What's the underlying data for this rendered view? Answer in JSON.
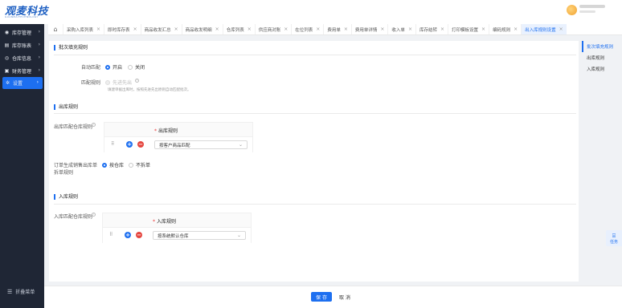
{
  "app": {
    "logo_text": "观麦科技",
    "logo_sub": "GUANMAITECHNOLOGY"
  },
  "sidebar": {
    "items": [
      {
        "label": "库存管理",
        "icon": "inventory-icon"
      },
      {
        "label": "库存账表",
        "icon": "ledger-icon"
      },
      {
        "label": "仓库信息",
        "icon": "warehouse-icon"
      },
      {
        "label": "财务管理",
        "icon": "finance-icon"
      },
      {
        "label": "设置",
        "icon": "settings-icon"
      }
    ],
    "collapse_label": "折叠菜单"
  },
  "tabs": [
    {
      "label": "采购入库列表"
    },
    {
      "label": "即时库存表"
    },
    {
      "label": "商品收发汇总"
    },
    {
      "label": "商品收发明细"
    },
    {
      "label": "仓库列表"
    },
    {
      "label": "供应商对账"
    },
    {
      "label": "在位列表"
    },
    {
      "label": "费用单"
    },
    {
      "label": "费用单详情"
    },
    {
      "label": "收入单"
    },
    {
      "label": "库存结转"
    },
    {
      "label": "打印模板设置"
    },
    {
      "label": "编码规则"
    },
    {
      "label": "出入库规则设置"
    }
  ],
  "batch": {
    "title": "批次填充规则",
    "auto_match_label": "自动匹配",
    "on_label": "开启",
    "off_label": "关闭",
    "match_rule_label": "匹配规则",
    "fifo_label": "先进先出",
    "hint": "填建单据出库时，按照先进先出原则自动匹配批次。"
  },
  "outbound": {
    "title": "出库规则",
    "match_label": "出库匹配仓库规则",
    "col_header": "出库规则",
    "select_value": "按客户商品匹配",
    "split_label_1": "订单生成销售出库单",
    "split_label_2": "拆单规则",
    "split_on": "按仓库",
    "split_off": "不拆单"
  },
  "inbound": {
    "title": "入库规则",
    "match_label": "入库匹配仓库规则",
    "col_header": "入库规则",
    "select_value": "按系统默认仓库"
  },
  "anchor": {
    "items": [
      "批次填充规则",
      "出库规则",
      "入库规则"
    ]
  },
  "task": {
    "label": "任务"
  },
  "footer": {
    "save_label": "保 存",
    "cancel_label": "取 消"
  }
}
